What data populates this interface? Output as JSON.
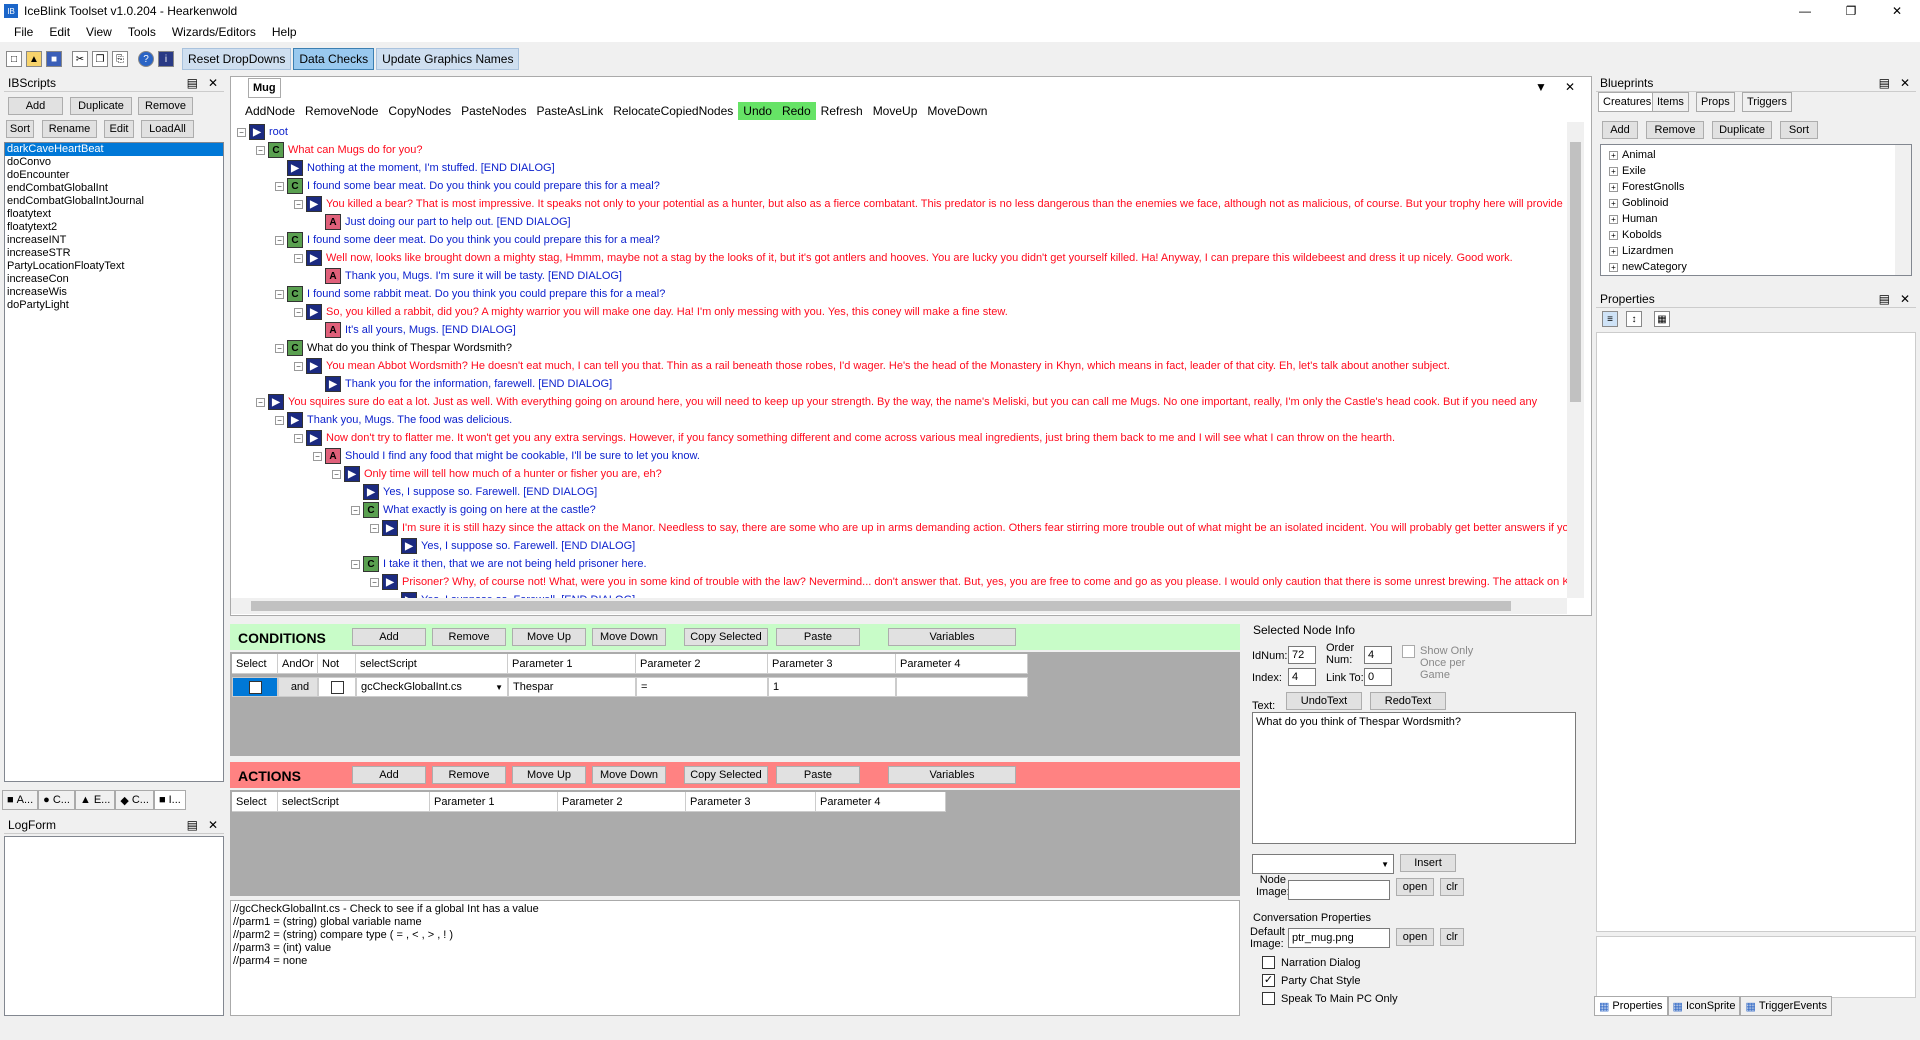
{
  "window": {
    "title": "IceBlink Toolset v1.0.204 - Hearkenwold",
    "app_icon": "IB",
    "controls": [
      "—",
      "❐",
      "✕"
    ]
  },
  "menu": [
    "File",
    "Edit",
    "View",
    "Tools",
    "Wizards/Editors",
    "Help"
  ],
  "toolbar": {
    "buttons": [
      "Reset DropDowns",
      "Data Checks",
      "Update Graphics Names"
    ]
  },
  "ibscripts": {
    "title": "IBScripts",
    "buttons": [
      "Add",
      "Duplicate",
      "Remove",
      "Sort",
      "Rename",
      "Edit",
      "LoadAll"
    ],
    "items": [
      "darkCaveHeartBeat",
      "doConvo",
      "doEncounter",
      "endCombatGlobalInt",
      "endCombatGlobalIntJournal",
      "floatytext",
      "floatytext2",
      "increaseINT",
      "increaseSTR",
      "PartyLocationFloatyText",
      "increaseCon",
      "increaseWis",
      "doPartyLight"
    ],
    "tabs": [
      "A...",
      "C...",
      "E...",
      "C...",
      "I..."
    ]
  },
  "logform": {
    "title": "LogForm"
  },
  "doc": {
    "tab": "Mug",
    "toolbar": [
      "AddNode",
      "RemoveNode",
      "CopyNodes",
      "PasteNodes",
      "PasteAsLink",
      "RelocateCopiedNodes",
      "Undo",
      "Redo",
      "Refresh",
      "MoveUp",
      "MoveDown"
    ]
  },
  "tree": [
    {
      "d": 0,
      "t": "",
      "txt": "root",
      "c": "blue",
      "e": "-"
    },
    {
      "d": 1,
      "t": "C",
      "txt": "What can Mugs do for you?",
      "c": "red",
      "e": "-"
    },
    {
      "d": 2,
      "t": "P",
      "txt": "Nothing at the moment, I'm stuffed. [END DIALOG]",
      "c": "blue",
      "e": ""
    },
    {
      "d": 2,
      "t": "C",
      "txt": "I found some bear meat. Do you think you could prepare this for a meal?",
      "c": "blue",
      "e": "-"
    },
    {
      "d": 3,
      "t": "P",
      "txt": "You killed a bear? That is most impressive. It speaks not only to your potential as a hunter, but also as a fierce combatant. This predator is no less dangerous than the enemies we face, although not as malicious, of course. But your trophy here will provide",
      "c": "red",
      "e": "-"
    },
    {
      "d": 4,
      "t": "A",
      "txt": "Just doing our part to help out. [END DIALOG]",
      "c": "blue",
      "e": ""
    },
    {
      "d": 2,
      "t": "C",
      "txt": "I found some deer meat. Do you think you could prepare this for a meal?",
      "c": "blue",
      "e": "-"
    },
    {
      "d": 3,
      "t": "P",
      "txt": "Well now, looks like brought down a mighty stag, Hmmm, maybe not a stag by the looks of it, but it's got antlers and hooves. You are lucky you didn't get yourself killed. Ha! Anyway, I can prepare this wildebeest and dress it up nicely. Good work.",
      "c": "red",
      "e": "-"
    },
    {
      "d": 4,
      "t": "A",
      "txt": "Thank you, Mugs. I'm sure it will be tasty. [END DIALOG]",
      "c": "blue",
      "e": ""
    },
    {
      "d": 2,
      "t": "C",
      "txt": "I found some rabbit meat. Do you think you could prepare this for a meal?",
      "c": "blue",
      "e": "-"
    },
    {
      "d": 3,
      "t": "P",
      "txt": "So, you killed a rabbit, did you? A mighty warrior you will make one day. Ha! I'm only messing with you. Yes, this coney will make a fine stew.",
      "c": "red",
      "e": "-"
    },
    {
      "d": 4,
      "t": "A",
      "txt": "It's all yours, Mugs. [END DIALOG]",
      "c": "blue",
      "e": ""
    },
    {
      "d": 2,
      "t": "C",
      "txt": "What do you think of Thespar Wordsmith?",
      "c": "black",
      "e": "-"
    },
    {
      "d": 3,
      "t": "P",
      "txt": "You mean Abbot Wordsmith? He doesn't eat much, I can tell you that. Thin as a rail beneath those robes, I'd wager. He's the head of the Monastery in Khyn, which means in fact, leader of that city. Eh, let's talk about another subject.",
      "c": "red",
      "e": "-"
    },
    {
      "d": 4,
      "t": "P",
      "txt": "Thank you for the information, farewell. [END DIALOG]",
      "c": "blue",
      "e": ""
    },
    {
      "d": 1,
      "t": "P",
      "txt": "You squires sure do eat a lot. Just as well. With everything going on around here, you will need to keep up your strength. By the way, the name's Meliski, but you can call me Mugs. No one important, really, I'm only the Castle's head cook. But if you need any",
      "c": "red",
      "e": "-"
    },
    {
      "d": 2,
      "t": "P",
      "txt": "Thank you, Mugs. The food was delicious.",
      "c": "blue",
      "e": "-"
    },
    {
      "d": 3,
      "t": "P",
      "txt": "Now don't try to flatter me. It won't get you any extra servings. However, if you fancy something different and come across various meal ingredients, just bring them back to me and I will see what I can throw on the hearth.",
      "c": "red",
      "e": "-"
    },
    {
      "d": 4,
      "t": "A",
      "txt": "Should I find any food that might be cookable, I'll be sure to let you know.",
      "c": "blue",
      "e": "-"
    },
    {
      "d": 5,
      "t": "P",
      "txt": "Only time will tell how much of a hunter or fisher you are, eh?",
      "c": "red",
      "e": "-"
    },
    {
      "d": 6,
      "t": "P",
      "txt": "Yes, I suppose so. Farewell. [END DIALOG]",
      "c": "blue",
      "e": ""
    },
    {
      "d": 6,
      "t": "C",
      "txt": "What exactly is going on here at the castle?",
      "c": "blue",
      "e": "-"
    },
    {
      "d": 7,
      "t": "P",
      "txt": "I'm sure it is still hazy since the attack on the Manor. Needless to say, there are some who are up in arms demanding action. Others fear stirring more trouble out of what might be an isolated incident. You will probably get better answers if you seek o",
      "c": "red",
      "e": "-"
    },
    {
      "d": 8,
      "t": "P",
      "txt": "Yes, I suppose so. Farewell. [END DIALOG]",
      "c": "blue",
      "e": ""
    },
    {
      "d": 6,
      "t": "C",
      "txt": "I take it then, that we are not being held prisoner here.",
      "c": "blue",
      "e": "-"
    },
    {
      "d": 7,
      "t": "P",
      "txt": "Prisoner? Why, of course not! What, were you in some kind of trouble with the law? Nevermind... don't answer that. But, yes, you are free to come and go as you please. I would only caution that there is some unrest brewing. The attack on Kelton I",
      "c": "red",
      "e": "-"
    },
    {
      "d": 8,
      "t": "P",
      "txt": "Yes, I suppose so. Farewell. [END DIALOG]",
      "c": "blue",
      "e": ""
    }
  ],
  "conditions": {
    "title": "CONDITIONS",
    "buttons": [
      "Add",
      "Remove",
      "Move Up",
      "Move Down",
      "Copy Selected",
      "Paste",
      "Variables"
    ],
    "headers": [
      "Select",
      "AndOr",
      "Not",
      "selectScript",
      "Parameter 1",
      "Parameter 2",
      "Parameter 3",
      "Parameter 4"
    ],
    "row": {
      "andor": "and",
      "script": "gcCheckGlobalInt.cs",
      "p1": "Thespar",
      "p2": "=",
      "p3": "1",
      "p4": ""
    }
  },
  "actions": {
    "title": "ACTIONS",
    "buttons": [
      "Add",
      "Remove",
      "Move Up",
      "Move Down",
      "Copy Selected",
      "Paste",
      "Variables"
    ],
    "headers": [
      "Select",
      "selectScript",
      "Parameter 1",
      "Parameter 2",
      "Parameter 3",
      "Parameter 4"
    ]
  },
  "script_desc": [
    "//gcCheckGlobalInt.cs - Check to see if a global Int has a value",
    "//parm1 = (string) global variable name",
    "//parm2 = (string) compare type ( = , < , > , ! )",
    "//parm3 = (int) value",
    "//parm4 = none"
  ],
  "node_info": {
    "title": "Selected Node Info",
    "idnum_label": "IdNum:",
    "idnum": "72",
    "order_label": "Order Num:",
    "order": "4",
    "index_label": "Index:",
    "index": "4",
    "linkto_label": "Link To:",
    "linkto": "0",
    "showonce": "Show Only Once per Game",
    "text_label": "Text:",
    "undo": "UndoText",
    "redo": "RedoText",
    "text": "What do you think of Thespar Wordsmith?",
    "insert": "Insert",
    "node_image_label": "Node Image:",
    "open": "open",
    "clr": "clr"
  },
  "conv_props": {
    "title": "Conversation Properties",
    "default_image_label": "Default Image:",
    "default_image": "ptr_mug.png",
    "open": "open",
    "clr": "clr",
    "checks": [
      {
        "label": "Narration Dialog",
        "checked": false
      },
      {
        "label": "Party Chat Style",
        "checked": true
      },
      {
        "label": "Speak To Main PC Only",
        "checked": false
      }
    ]
  },
  "blueprints": {
    "title": "Blueprints",
    "tabs": [
      "Creatures",
      "Items",
      "Props",
      "Triggers"
    ],
    "buttons": [
      "Add",
      "Remove",
      "Duplicate",
      "Sort"
    ],
    "items": [
      "Animal",
      "Exile",
      "ForestGnolls",
      "Goblinoid",
      "Human",
      "Kobolds",
      "Lizardmen",
      "newCategory"
    ]
  },
  "properties": {
    "title": "Properties",
    "tabs": [
      "Properties",
      "IconSprite",
      "TriggerEvents"
    ]
  },
  "pin": " ⊟ ",
  "close": "✕"
}
